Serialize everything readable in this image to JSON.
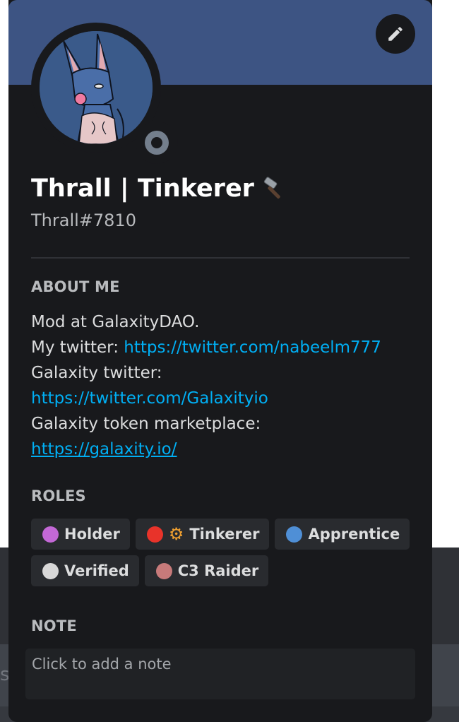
{
  "background": {
    "ghost_text": "s"
  },
  "profile": {
    "display_name": "Thrall | Tinkerer",
    "name_emoji": "hammer-icon",
    "username": "Thrall#7810",
    "status": "offline",
    "banner_color": "#3d5483"
  },
  "about": {
    "heading": "ABOUT ME",
    "line1": "Mod at GalaxityDAO.",
    "line2_prefix": "My twitter: ",
    "link1": "https://twitter.com/nabeelm777",
    "line3": "Galaxity twitter:",
    "link2": "https://twitter.com/Galaxityio",
    "line4": "Galaxity token marketplace:",
    "link3": "https://galaxity.io/"
  },
  "roles": {
    "heading": "ROLES",
    "items": [
      {
        "label": "Holder",
        "color": "#c368d6",
        "icon": ""
      },
      {
        "label": "Tinkerer",
        "color": "#e8332a",
        "icon": "gear-icon"
      },
      {
        "label": "Apprentice",
        "color": "#4f8fd6",
        "icon": ""
      },
      {
        "label": "Verified",
        "color": "#d8d8d8",
        "icon": ""
      },
      {
        "label": "C3 Raider",
        "color": "#c77a7a",
        "icon": ""
      }
    ]
  },
  "note": {
    "heading": "NOTE",
    "placeholder": "Click to add a note"
  }
}
